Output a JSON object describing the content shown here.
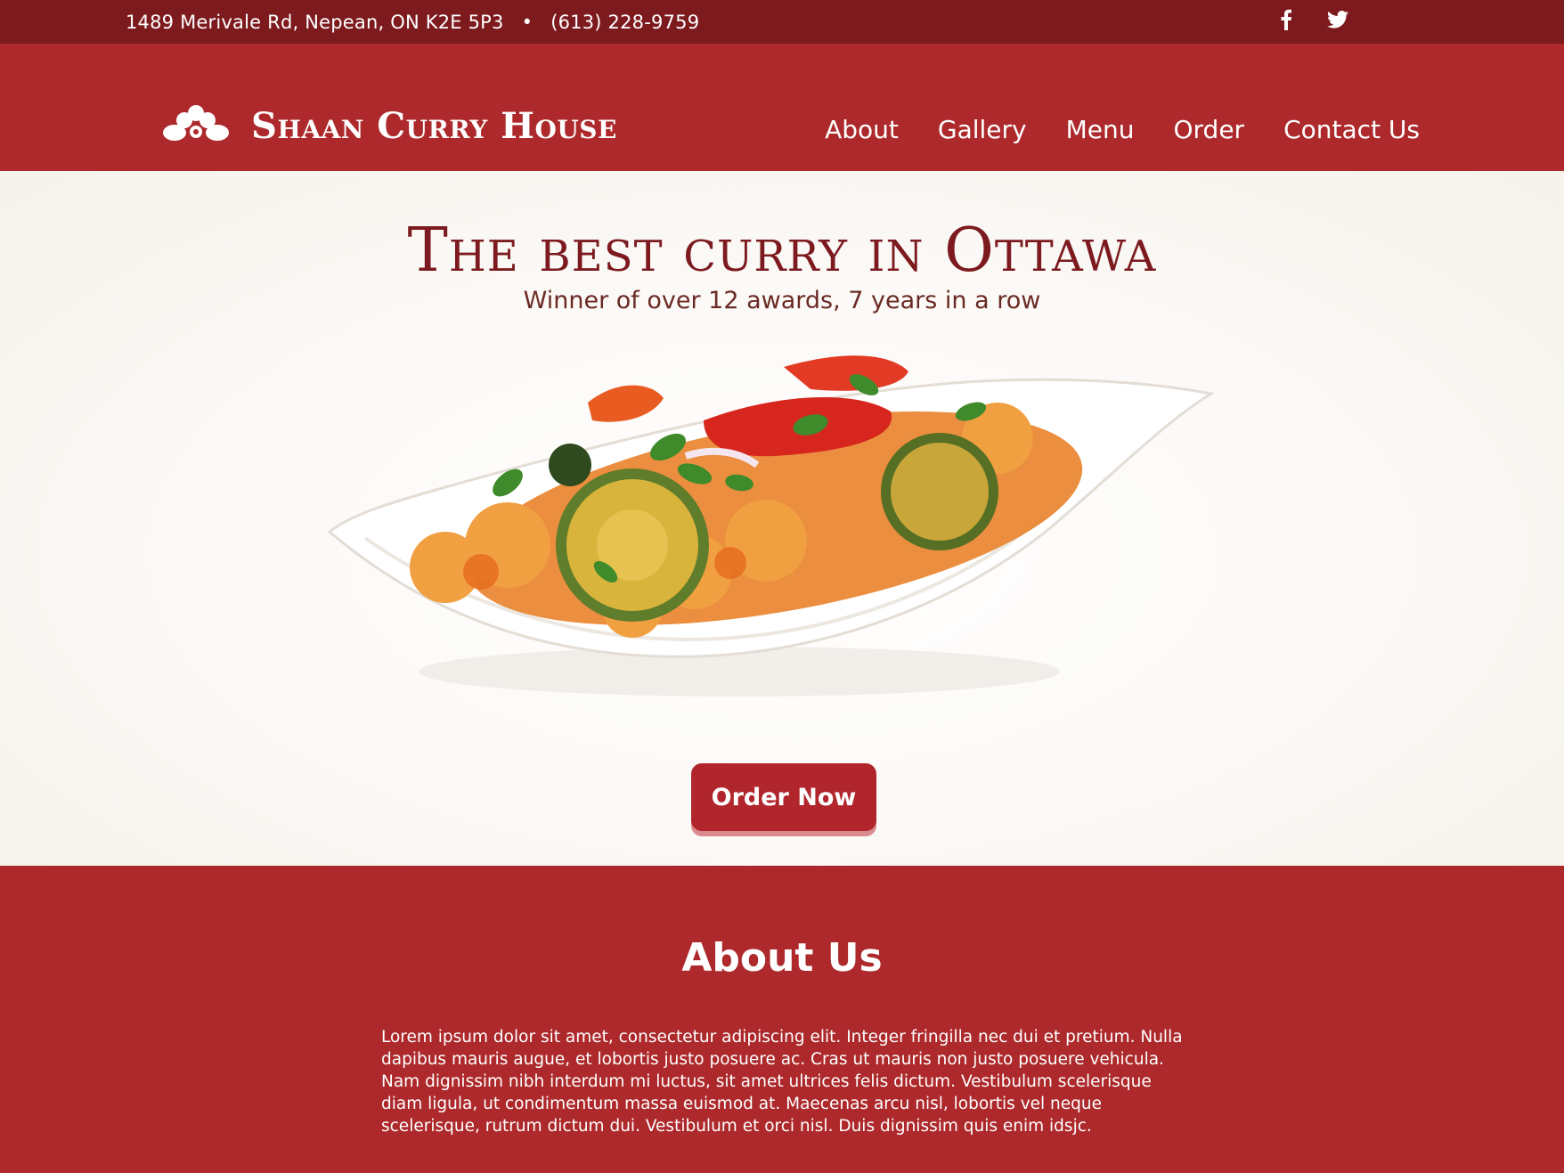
{
  "topbar": {
    "address": "1489 Merivale Rd, Nepean, ON K2E 5P3",
    "separator": "•",
    "phone": "(613) 228-9759",
    "social": [
      "facebook-icon",
      "twitter-icon"
    ]
  },
  "header": {
    "brand": "Shaan Curry House",
    "logo_icon": "lotus-icon",
    "nav": [
      "About",
      "Gallery",
      "Menu",
      "Order",
      "Contact Us"
    ]
  },
  "hero": {
    "title": "The best curry in Ottawa",
    "subtitle": "Winner of over 12 awards, 7 years in a row",
    "image": "curry-dish-image",
    "cta": "Order Now"
  },
  "about": {
    "heading": "About Us",
    "body": "Lorem ipsum dolor sit amet, consectetur adipiscing elit. Integer fringilla nec dui et pretium. Nulla dapibus mauris augue, et lobortis justo posuere ac. Cras ut mauris non justo posuere vehicula. Nam dignissim nibh interdum mi luctus, sit amet ultrices felis dictum. Vestibulum scelerisque diam ligula, ut condimentum massa euismod at. Maecenas arcu nisl, lobortis vel neque scelerisque, rutrum dictum dui. Vestibulum et orci nisl. Duis dignissim quis enim idsjc."
  },
  "colors": {
    "topbar": "#7d1a1e",
    "primary": "#ad292b",
    "title": "#7c1a1f",
    "background": "#faf8f5"
  }
}
